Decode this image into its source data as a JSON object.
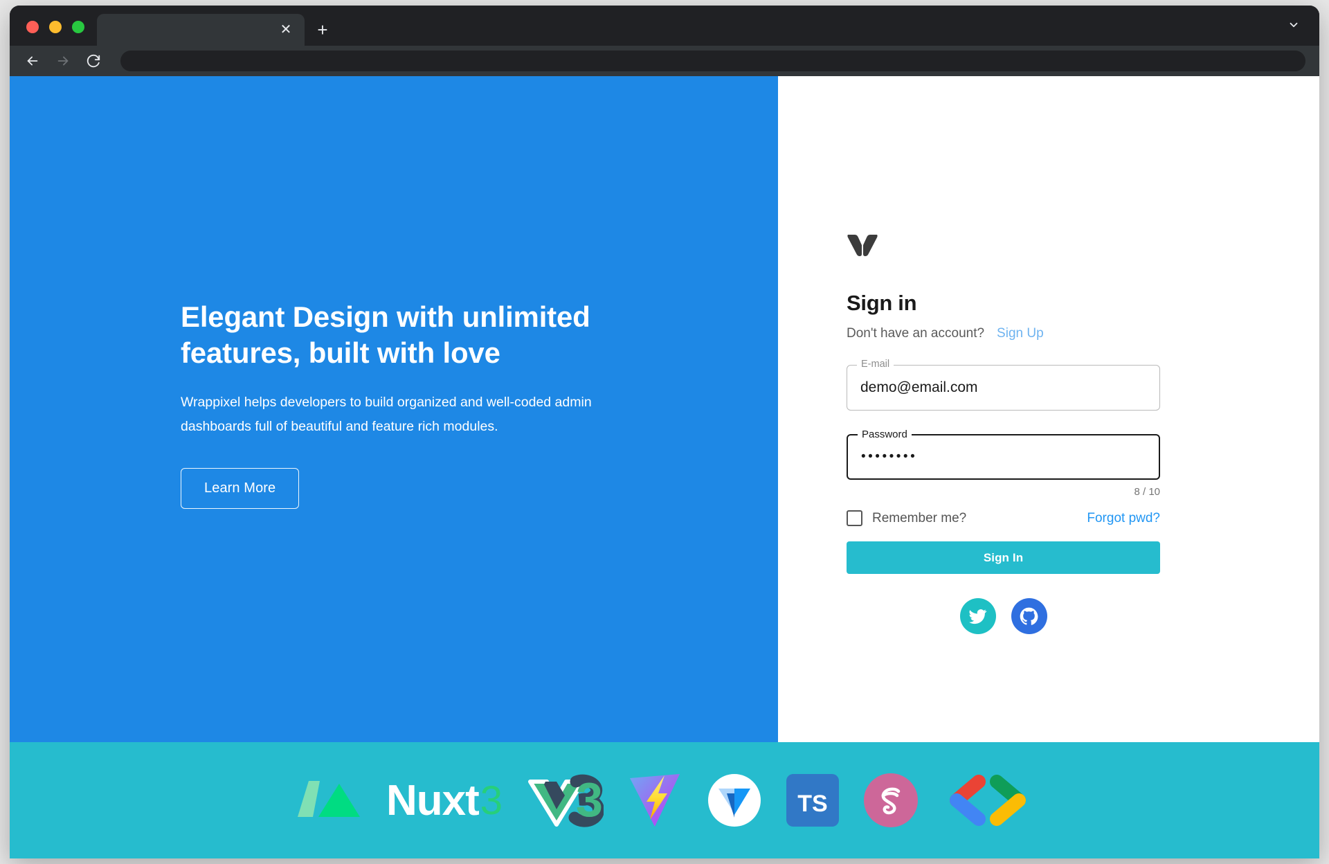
{
  "browser": {
    "traffic_lights": [
      "close",
      "minimize",
      "maximize"
    ],
    "tab_title": "",
    "tab_close_glyph": "✕",
    "new_tab_glyph": "+",
    "tabstrip_chevron": "chevron-down",
    "url_value": "",
    "url_placeholder": "",
    "back_label": "Back",
    "forward_label": "Forward",
    "reload_label": "Reload"
  },
  "hero": {
    "title": "Elegant Design with unlimited features, built with love",
    "description": "Wrappixel helps developers to build organized and well-coded admin dashboards full of beautiful and feature rich modules.",
    "cta_label": "Learn More",
    "bg_color": "#1e88e5"
  },
  "form": {
    "logo_name": "wrappixel-logo",
    "title": "Sign in",
    "account_question": "Don't have an account?",
    "signup_label": "Sign Up",
    "email": {
      "label": "E-mail",
      "value": "demo@email.com",
      "placeholder": "E-mail"
    },
    "password": {
      "label": "Password",
      "value": "••••••••",
      "placeholder": "Password",
      "counter": "8 / 10"
    },
    "remember_label": "Remember me?",
    "remember_checked": false,
    "forgot_label": "Forgot pwd?",
    "submit_label": "Sign In",
    "submit_color": "#26bcce",
    "link_color": "#2196f3",
    "signup_link_color": "#6eb3f0",
    "socials": [
      {
        "name": "twitter",
        "bg": "#1ec0c4"
      },
      {
        "name": "github",
        "bg": "#2f6fe0"
      }
    ]
  },
  "tech_bar": {
    "bg_color": "#26bcce",
    "items": [
      {
        "name": "nuxt",
        "word": "Nuxt",
        "version": "3"
      },
      {
        "name": "vue",
        "version": "3"
      },
      {
        "name": "vite"
      },
      {
        "name": "vuetify"
      },
      {
        "name": "typescript",
        "abbr": "TS"
      },
      {
        "name": "sass"
      },
      {
        "name": "code-brackets"
      }
    ]
  }
}
